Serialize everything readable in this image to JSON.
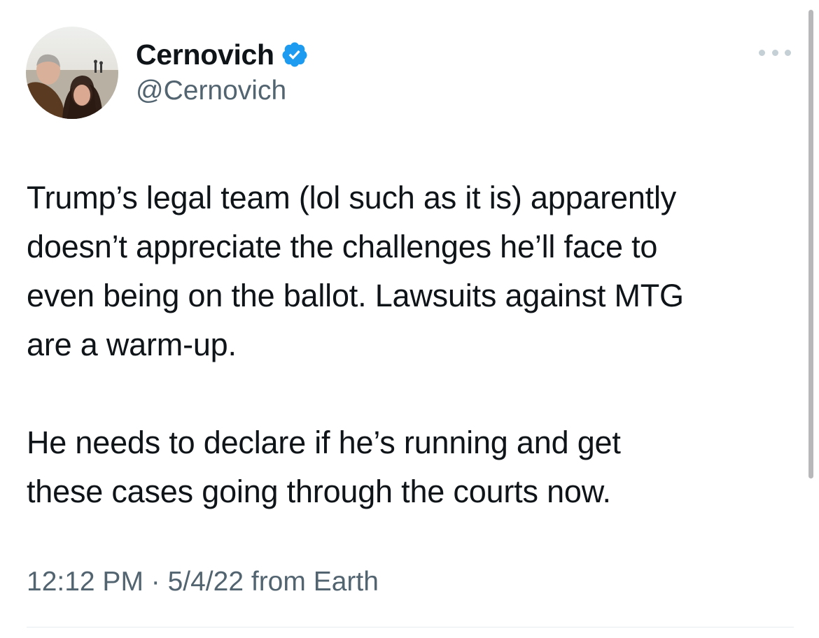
{
  "author": {
    "display_name": "Cernovich",
    "handle": "@Cernovich",
    "verified_icon": "verified-badge-icon",
    "avatar_icon": "profile-photo"
  },
  "more_menu": {
    "icon": "more-horizontal-icon"
  },
  "tweet": {
    "paragraphs": [
      "Trump’s legal team (lol such as it is) apparently\ndoesn’t appreciate the challenges he’ll face to\neven being on the ballot. Lawsuits against MTG\nare a warm-up.",
      "He needs to declare if he’s running and get\nthese cases going through the courts now."
    ],
    "meta": "12:12 PM · 5/4/22 from Earth"
  },
  "colors": {
    "text": "#0f1419",
    "secondary_text": "#536471",
    "verified_blue": "#1d9bf0",
    "divider": "#e6ecf0"
  }
}
